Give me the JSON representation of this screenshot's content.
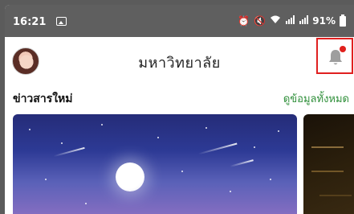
{
  "status_bar": {
    "time": "16:21",
    "battery_percent": "91%"
  },
  "header": {
    "title": "มหาวิทยาลัย",
    "notification_has_badge": true,
    "badge_color": "#e0211d",
    "highlight_color": "#e02020"
  },
  "section": {
    "title": "ข่าวสารใหม่",
    "see_all_label": "ดูข้อมูลทั้งหมด",
    "see_all_color": "#2f8f3a"
  },
  "cards": [
    {
      "image": "night-sky-moon-illustration"
    },
    {
      "image": "dark-partial-card"
    }
  ]
}
